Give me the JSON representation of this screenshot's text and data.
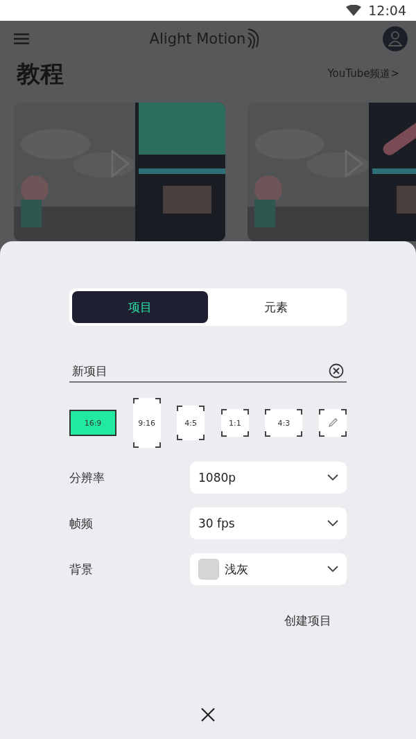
{
  "status_bar": {
    "time": "12:04"
  },
  "app_bar": {
    "logo": "Alight Motion"
  },
  "section": {
    "title": "教程",
    "link": "YouTube频道>"
  },
  "sheet": {
    "tabs": [
      {
        "label": "项目",
        "selected": true
      },
      {
        "label": "元素",
        "selected": false
      }
    ],
    "name_field": {
      "value": "新项目"
    },
    "ratios": [
      {
        "kind": "ratio",
        "label": "16:9",
        "selected": true
      },
      {
        "kind": "ratio",
        "label": "9:16",
        "selected": false
      },
      {
        "kind": "ratio",
        "label": "4:5",
        "selected": false
      },
      {
        "kind": "ratio",
        "label": "1:1",
        "selected": false
      },
      {
        "kind": "ratio",
        "label": "4:3",
        "selected": false
      },
      {
        "kind": "custom",
        "selected": false
      }
    ],
    "settings": [
      {
        "label": "分辨率",
        "value": "1080p"
      },
      {
        "label": "帧频",
        "value": "30 fps"
      },
      {
        "label": "背景",
        "value": "浅灰",
        "color": "#d6d6d6"
      }
    ],
    "create_button": "创建项目"
  }
}
